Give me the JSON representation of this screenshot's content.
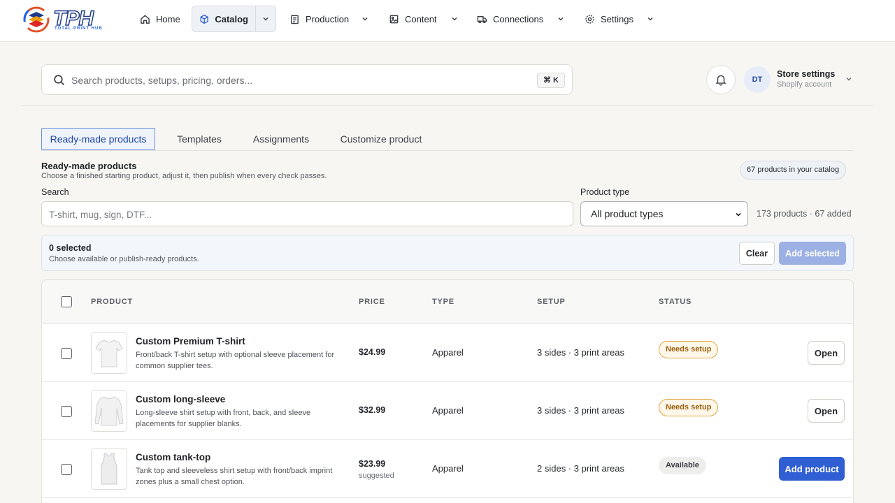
{
  "nav": {
    "logo_text": "TPH",
    "logo_sub": "TOTAL PRINT HUB",
    "home": "Home",
    "catalog": "Catalog",
    "production": "Production",
    "content": "Content",
    "connections": "Connections",
    "settings": "Settings"
  },
  "search": {
    "placeholder": "Search products, setups, pricing, orders...",
    "shortcut": "⌘ K"
  },
  "account": {
    "initials": "DT",
    "title": "Store settings",
    "subtitle": "Shopify account"
  },
  "tabs": [
    "Ready-made products",
    "Templates",
    "Assignments",
    "Customize product"
  ],
  "section": {
    "title": "Ready-made products",
    "subtitle": "Choose a finished starting product, adjust it, then publish when every check passes.",
    "catalog_count": "67 products in your catalog"
  },
  "filters": {
    "search_label": "Search",
    "search_placeholder": "T-shirt, mug, sign, DTF...",
    "type_label": "Product type",
    "type_value": "All product types",
    "count_text": "173 products · 67 added"
  },
  "selection": {
    "count": "0 selected",
    "hint": "Choose available or publish-ready products.",
    "clear": "Clear",
    "add_selected": "Add selected"
  },
  "table": {
    "headers": [
      "PRODUCT",
      "PRICE",
      "TYPE",
      "SETUP",
      "STATUS"
    ],
    "rows": [
      {
        "name": "Custom Premium T-shirt",
        "desc": "Front/back T-shirt setup with optional sleeve placement for common supplier tees.",
        "price": "$24.99",
        "price_sub": "",
        "type": "Apparel",
        "setup": "3 sides · 3 print areas",
        "status": "Needs setup",
        "action": "Open"
      },
      {
        "name": "Custom long-sleeve",
        "desc": "Long-sleeve shirt setup with front, back, and sleeve placements for supplier blanks.",
        "price": "$32.99",
        "price_sub": "",
        "type": "Apparel",
        "setup": "3 sides · 3 print areas",
        "status": "Needs setup",
        "action": "Open"
      },
      {
        "name": "Custom tank-top",
        "desc": "Tank top and sleeveless shirt setup with front/back imprint zones plus a small chest option.",
        "price": "$23.99",
        "price_sub": "suggested",
        "type": "Apparel",
        "setup": "2 sides · 3 print areas",
        "status": "Available",
        "action": "Add product"
      }
    ]
  }
}
